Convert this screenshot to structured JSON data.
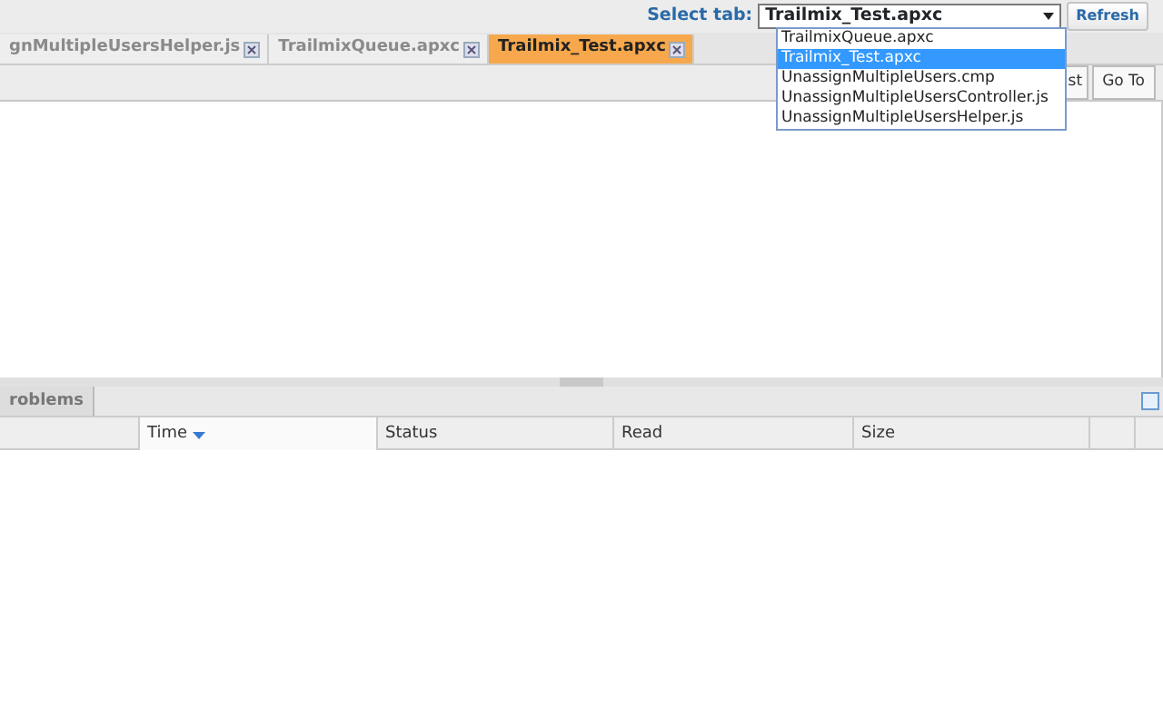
{
  "header": {
    "label": "Select tab:",
    "select": {
      "value": "Trailmix_Test.apxc",
      "expanded": true,
      "options": [
        {
          "label": "TrailmixQueue.apxc",
          "selected": false
        },
        {
          "label": "Trailmix_Test.apxc",
          "selected": true
        },
        {
          "label": "UnassignMultipleUsers.cmp",
          "selected": false
        },
        {
          "label": "UnassignMultipleUsersController.js",
          "selected": false
        },
        {
          "label": "UnassignMultipleUsersHelper.js",
          "selected": false
        }
      ]
    },
    "refresh_button": "Refresh"
  },
  "tabs": [
    {
      "label": "gnMultipleUsersHelper.js",
      "selected": false
    },
    {
      "label": "TrailmixQueue.apxc",
      "selected": false
    },
    {
      "label": "Trailmix_Test.apxc",
      "selected": true
    }
  ],
  "toolbar_buttons": [
    "st",
    "Go To"
  ],
  "bottom_panel": {
    "tabs": [
      {
        "label": "roblems",
        "selected": true
      }
    ],
    "columns": [
      {
        "label": "Time",
        "sorted": true
      },
      {
        "label": "Status",
        "sorted": false
      },
      {
        "label": "Read",
        "sorted": false
      },
      {
        "label": "Size",
        "sorted": false
      }
    ]
  }
}
